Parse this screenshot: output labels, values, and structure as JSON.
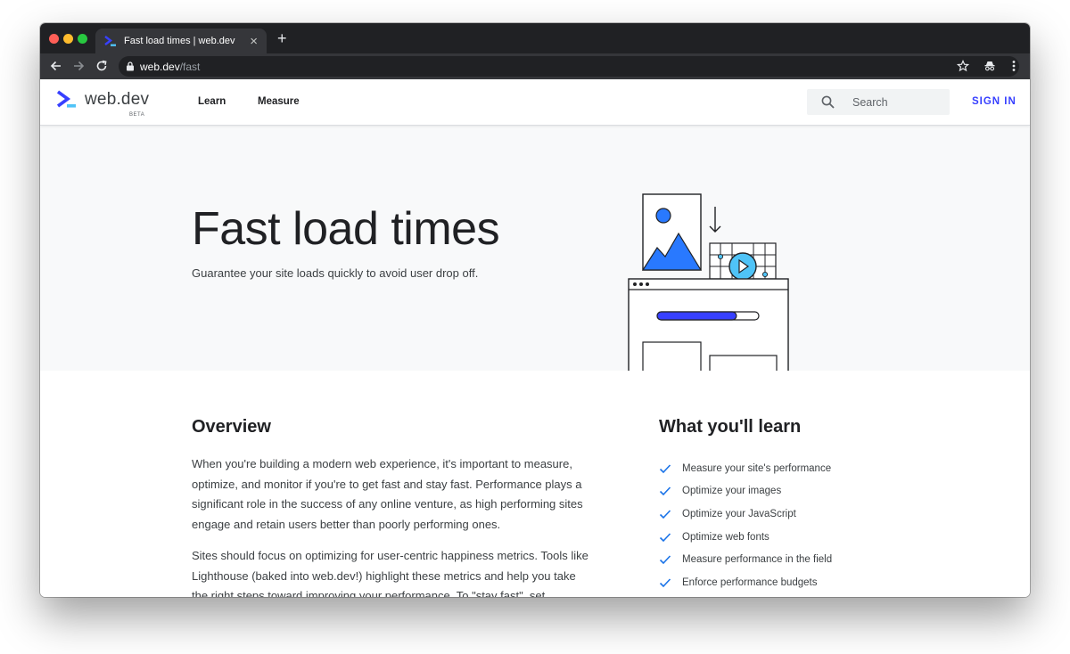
{
  "browser": {
    "tab_title": "Fast load times  |  web.dev",
    "new_tab_glyph": "+",
    "close_glyph": "×",
    "url_host": "web.dev",
    "url_path": "/fast"
  },
  "header": {
    "logo_text": "web.dev",
    "logo_badge": "BETA",
    "nav": [
      "Learn",
      "Measure"
    ],
    "search_placeholder": "Search",
    "sign_in": "SIGN IN"
  },
  "hero": {
    "title": "Fast load times",
    "subtitle": "Guarantee your site loads quickly to avoid user drop off.",
    "progress_fraction": 0.78
  },
  "overview": {
    "title": "Overview",
    "paragraphs": [
      "When you're building a modern web experience, it's important to measure, optimize, and monitor if you're to get fast and stay fast. Performance plays a significant role in the success of any online venture, as high performing sites engage and retain users better than poorly performing ones.",
      "Sites should focus on optimizing for user-centric happiness metrics. Tools like Lighthouse (baked into web.dev!) highlight these metrics and help you take the right steps toward improving your performance. To \"stay fast\", set"
    ]
  },
  "learn": {
    "title": "What you'll learn",
    "items": [
      "Measure your site's performance",
      "Optimize your images",
      "Optimize your JavaScript",
      "Optimize web fonts",
      "Measure performance in the field",
      "Enforce performance budgets"
    ]
  },
  "colors": {
    "brand_blue": "#3740ff",
    "accent_blue": "#2979ff",
    "art_teal": "#4fc3f7",
    "check_blue": "#1a73e8",
    "chrome_dark": "#202124",
    "chrome_toolbar": "#35363a"
  },
  "icons": {
    "back": "arrow-left-icon",
    "forward": "arrow-right-icon",
    "reload": "reload-icon",
    "lock": "lock-icon",
    "bookmark": "star-icon",
    "incognito": "incognito-icon",
    "menu": "kebab-menu-icon",
    "search": "search-icon",
    "check": "check-icon"
  }
}
